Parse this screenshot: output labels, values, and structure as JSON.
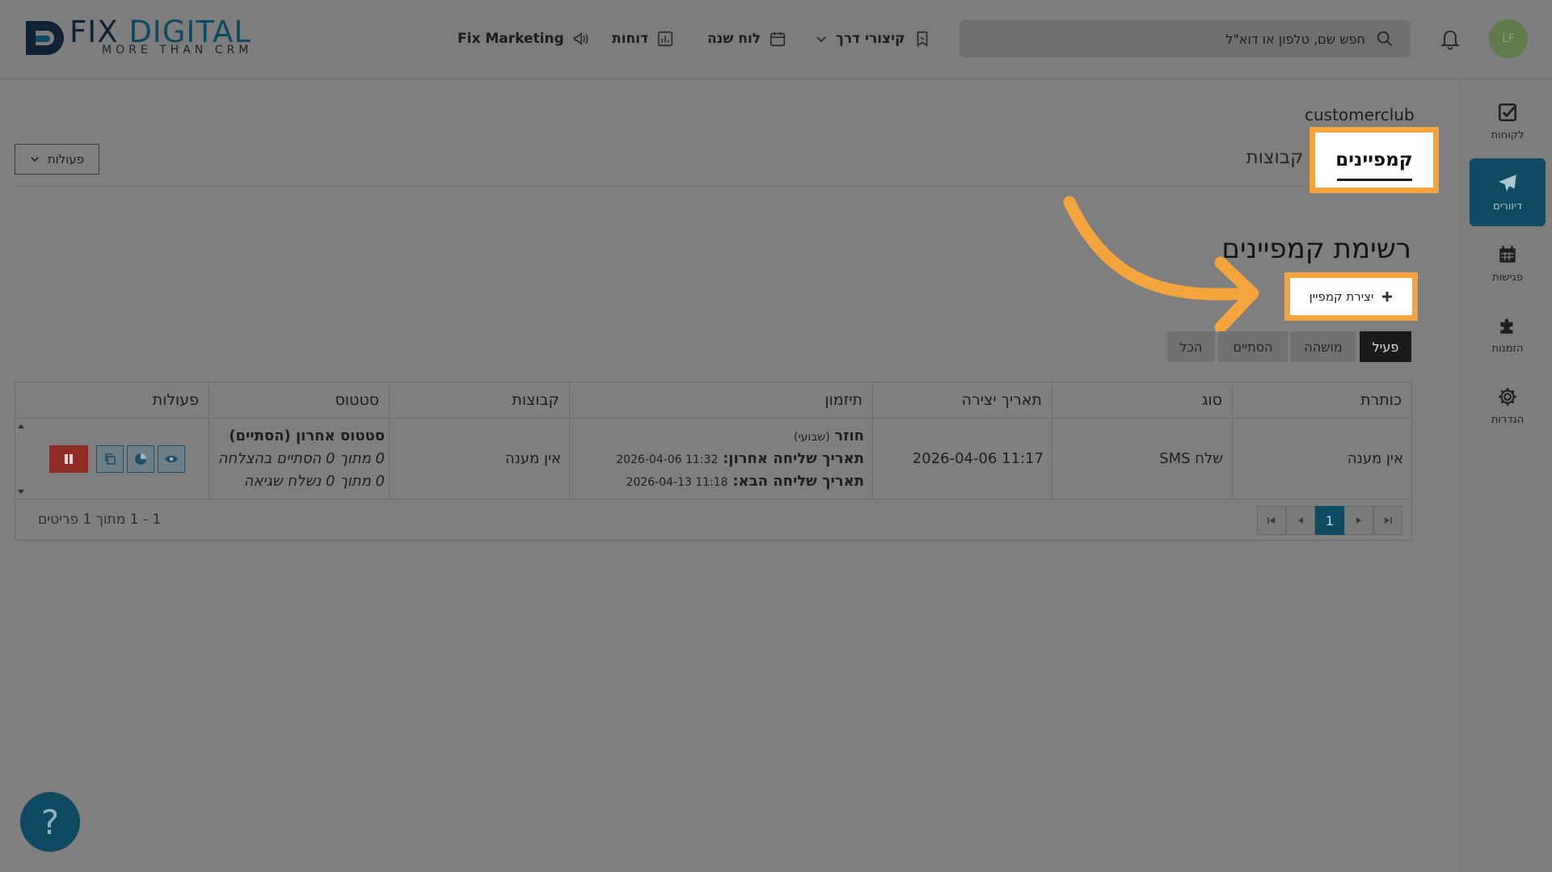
{
  "header": {
    "logo": {
      "word1": "FIX",
      "word2": "DIGITAL",
      "tagline": "MORE THAN CRM"
    },
    "nav": {
      "marketing": "Fix Marketing",
      "reports": "דוחות",
      "calendar": "לוח שנה",
      "shortcuts": "קיצורי דרך"
    },
    "search": {
      "placeholder": "חפש שם, טלפון או דוא\"ל"
    },
    "avatar": {
      "initials": "LF"
    }
  },
  "sidebar": {
    "items": [
      {
        "label": "לקוחות",
        "icon": "check-square-icon"
      },
      {
        "label": "דיוורים",
        "icon": "paper-plane-icon",
        "active": true
      },
      {
        "label": "פגישות",
        "icon": "calendar-icon"
      },
      {
        "label": "הזמנות",
        "icon": "puzzle-icon"
      },
      {
        "label": "הגדרות",
        "icon": "gear-icon"
      }
    ]
  },
  "main": {
    "breadcrumb": "customerclub",
    "actions_label": "פעולות",
    "tabs": [
      {
        "label": "קמפיינים",
        "active": true
      },
      {
        "label": "קבוצות"
      }
    ],
    "title": "רשימת קמפיינים",
    "create_label": "יצירת קמפיין",
    "filters": [
      {
        "label": "פעיל",
        "active": true
      },
      {
        "label": "מושהה"
      },
      {
        "label": "הסתיים"
      },
      {
        "label": "הכל"
      }
    ],
    "table": {
      "columns": [
        "כותרת",
        "סוג",
        "תאריך יצירה",
        "תיזמון",
        "קבוצות",
        "סטטוס",
        "פעולות"
      ],
      "rows": [
        {
          "title": "אין מענה",
          "type": "שלח SMS",
          "created": "2026-04-06 11:17",
          "schedule": {
            "recurring_label": "חוזר",
            "recurring_period": "(שבועי)",
            "last_label": "תאריך שליחה אחרון:",
            "last_value": "2026-04-06 11:32",
            "next_label": "תאריך שליחה הבא:",
            "next_value": "2026-04-13 11:18"
          },
          "groups": "אין מענה",
          "status": {
            "title": "סטטוס אחרון (הסתיים)",
            "success": "0 מתוך 0 הסתיים בהצלחה",
            "errors": "0 מתוך 0 נשלח שגיאה"
          }
        }
      ],
      "pagination": {
        "current": "1"
      },
      "count": "1 - 1 מתוך 1 פריטים"
    }
  },
  "help_label": "?",
  "colors": {
    "accent": "#0f4a63",
    "highlight": "#f4a43d",
    "pause": "#8f2a24"
  }
}
